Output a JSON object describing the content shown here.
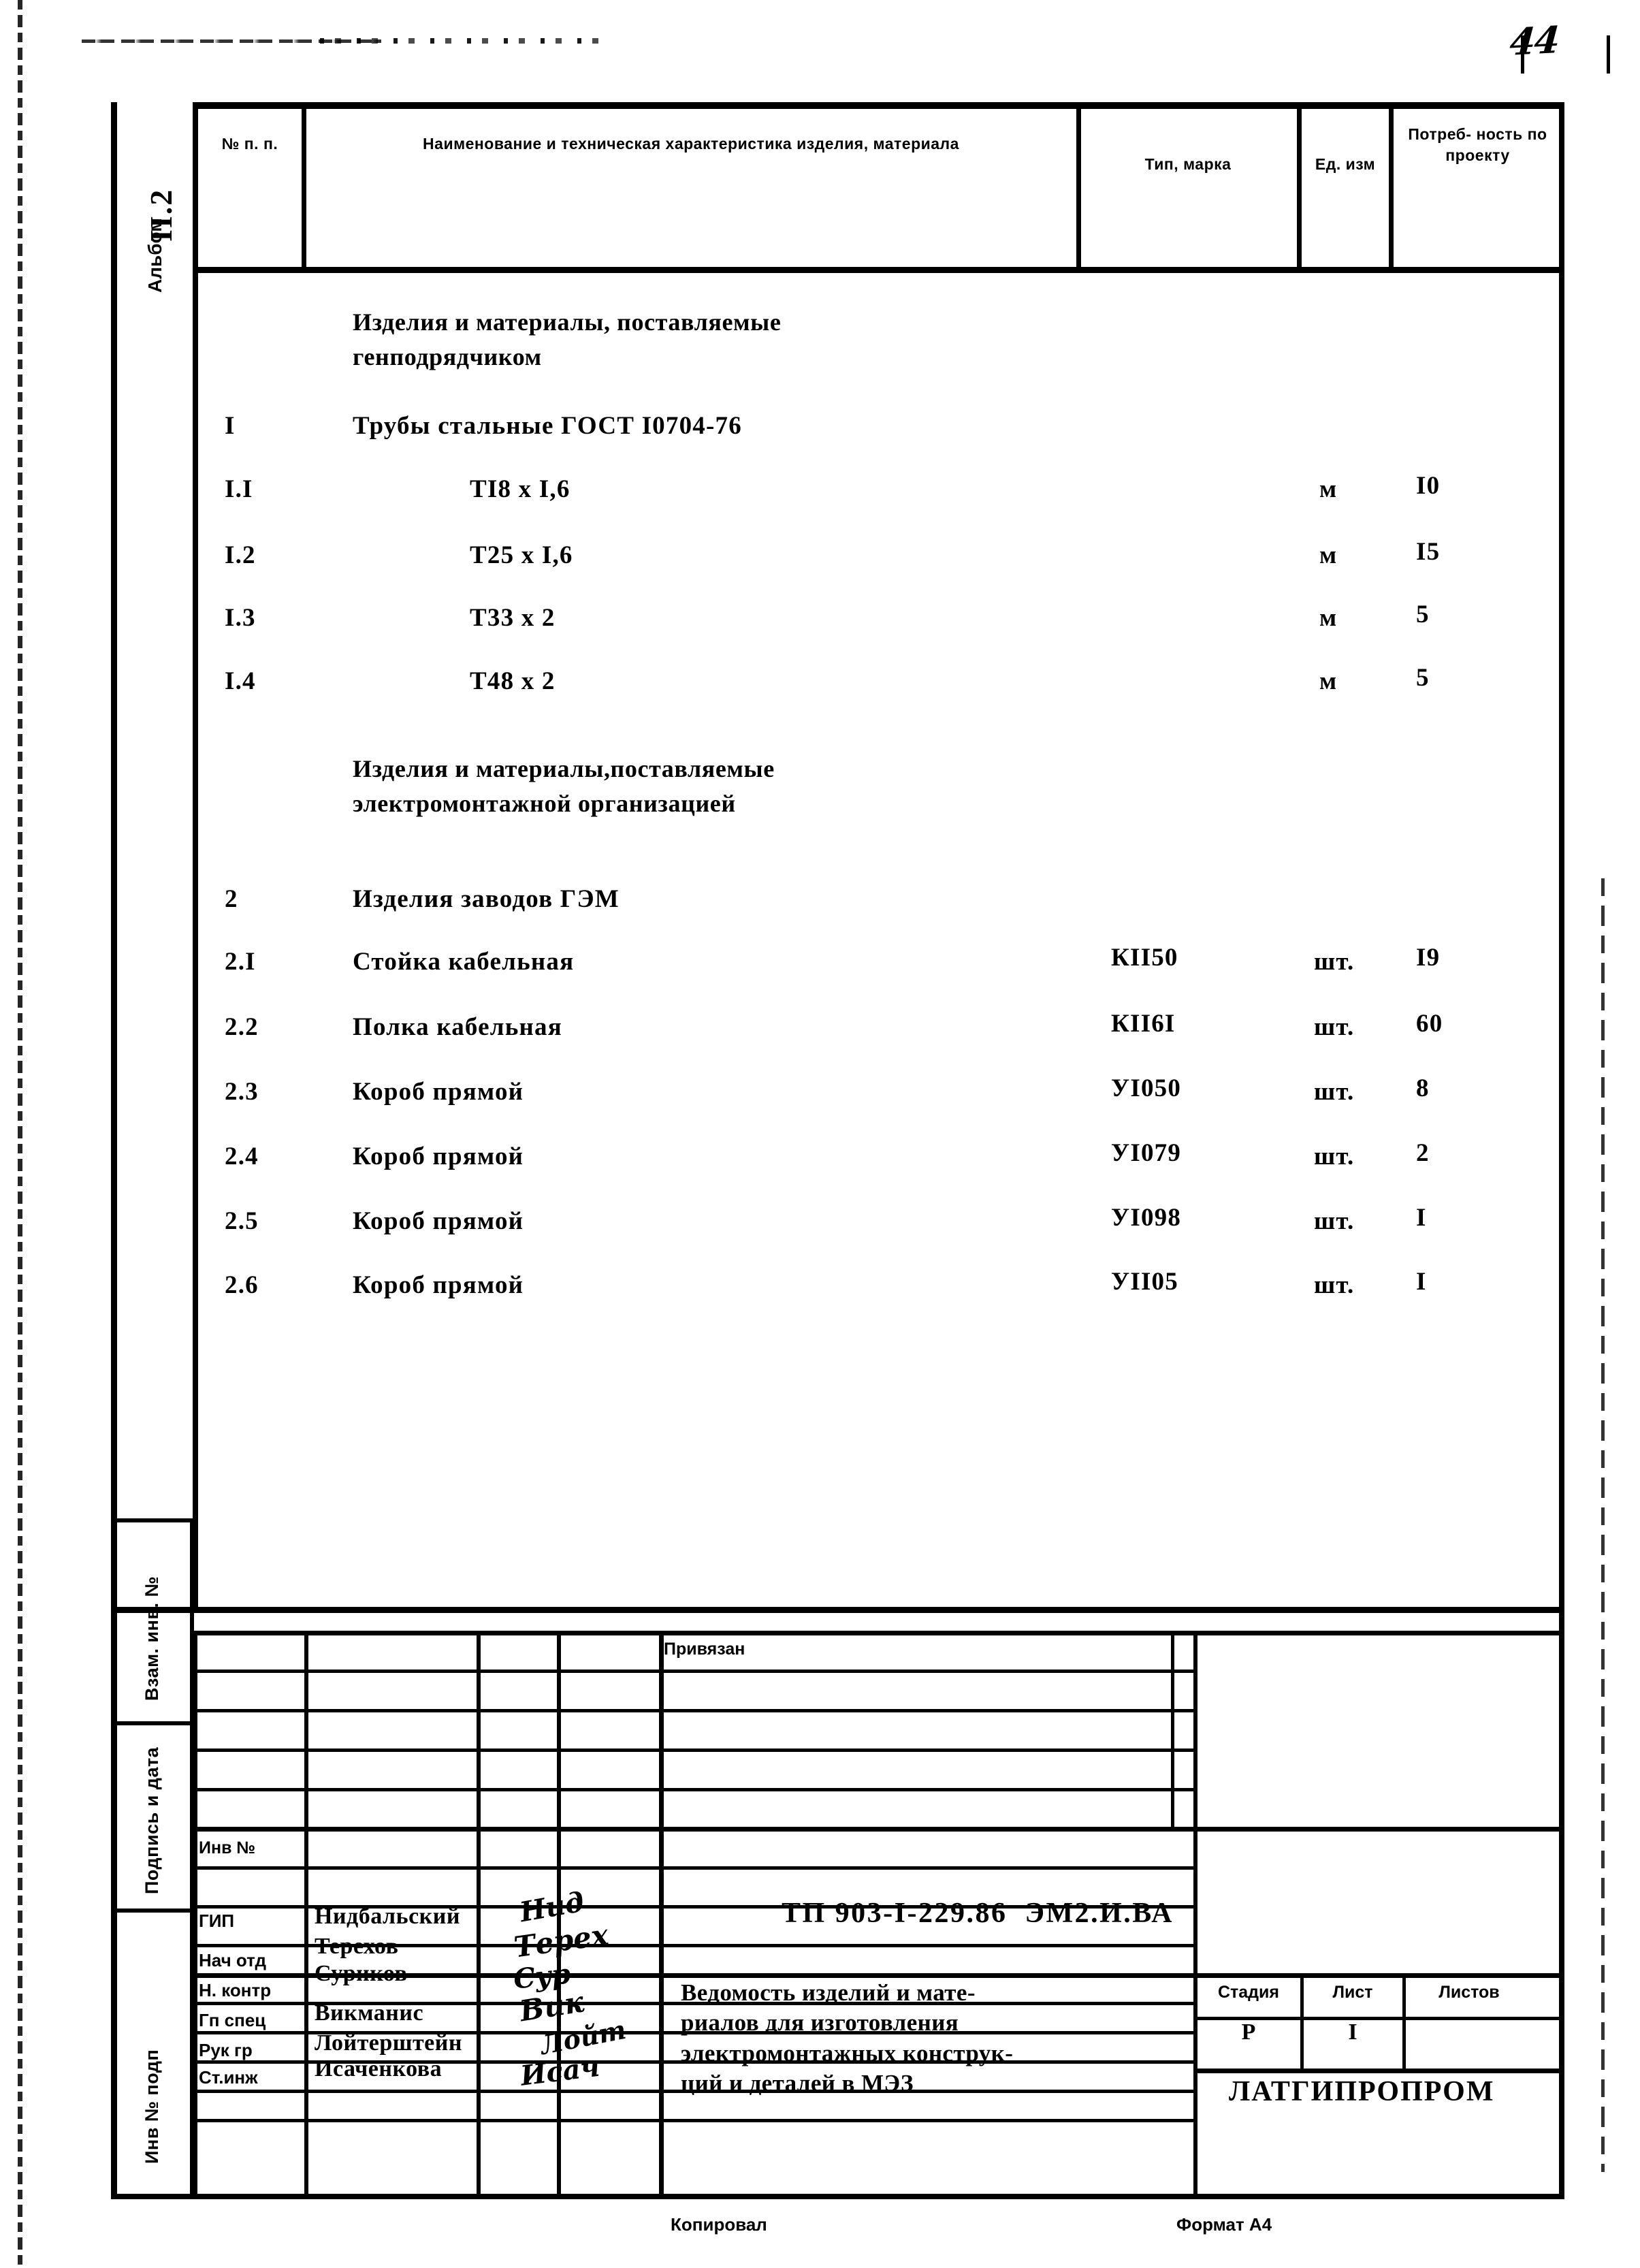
{
  "page": {
    "number": "44",
    "album_code": "II.2",
    "album_word": "Альбом"
  },
  "table": {
    "headers": {
      "no": "№\nп. п.",
      "name": "Наименование и техническая характеристика\nизделия, материала",
      "type": "Тип, марка",
      "unit": "Ед.\nизм",
      "qty": "Потреб-\nность по\nпроекту"
    },
    "rows": [
      {
        "kind": "section",
        "no": "",
        "name": "Изделия и материалы, поставляемые\nгенподрядчиком",
        "type": "",
        "unit": "",
        "qty": ""
      },
      {
        "kind": "group",
        "no": "I",
        "name": "Трубы стальные ГОСТ I0704-76",
        "type": "",
        "unit": "",
        "qty": ""
      },
      {
        "kind": "item",
        "no": "I.I",
        "name": "TI8 x I,6",
        "type": "",
        "unit": "м",
        "qty": "I0"
      },
      {
        "kind": "item",
        "no": "I.2",
        "name": "T25 x I,6",
        "type": "",
        "unit": "м",
        "qty": "I5"
      },
      {
        "kind": "item",
        "no": "I.3",
        "name": "T33 x 2",
        "type": "",
        "unit": "м",
        "qty": "5"
      },
      {
        "kind": "item",
        "no": "I.4",
        "name": "T48 x 2",
        "type": "",
        "unit": "м",
        "qty": "5"
      },
      {
        "kind": "section",
        "no": "",
        "name": "Изделия и материалы,поставляемые\nэлектромонтажной организацией",
        "type": "",
        "unit": "",
        "qty": ""
      },
      {
        "kind": "group",
        "no": "2",
        "name": "Изделия заводов ГЭМ",
        "type": "",
        "unit": "",
        "qty": ""
      },
      {
        "kind": "item",
        "no": "2.I",
        "name": "Стойка кабельная",
        "type": "КII50",
        "unit": "шт.",
        "qty": "I9"
      },
      {
        "kind": "item",
        "no": "2.2",
        "name": "Полка кабельная",
        "type": "КII6I",
        "unit": "шт.",
        "qty": "60"
      },
      {
        "kind": "item",
        "no": "2.3",
        "name": "Короб прямой",
        "type": "УI050",
        "unit": "шт.",
        "qty": "8"
      },
      {
        "kind": "item",
        "no": "2.4",
        "name": "Короб прямой",
        "type": "УI079",
        "unit": "шт.",
        "qty": "2"
      },
      {
        "kind": "item",
        "no": "2.5",
        "name": "Короб прямой",
        "type": "УI098",
        "unit": "шт.",
        "qty": "I"
      },
      {
        "kind": "item",
        "no": "2.6",
        "name": "Короб прямой",
        "type": "УII05",
        "unit": "шт.",
        "qty": "I"
      }
    ]
  },
  "margin_labels": {
    "vzam": "Взам. инв. №",
    "podpis": "Подпись и дата",
    "inv_podp": "Инв № подп"
  },
  "title_block": {
    "privyazan": "Привязан",
    "inv_no": "Инв №",
    "doc_code": "ТП 903-I-229.86  ЭМ2.И.ВА",
    "doc_title": "Ведомость изделий и мате-\nриалов для изготовления\nэлектромонтажных конструк-\nций и деталей в МЭЗ",
    "organization": "ЛАТГИПРОПРОМ",
    "stage": {
      "stage_label": "Стадия",
      "sheet_label": "Лист",
      "sheets_label": "Листов",
      "stage_value": "Р",
      "sheet_value": "I",
      "sheets_value": ""
    },
    "signatures": [
      {
        "role": "ГИП",
        "name": "Нидбальский",
        "mark": "Нид"
      },
      {
        "role": "Нач  отд",
        "name": "Терехов",
        "mark": "Терех"
      },
      {
        "role": "Н. контр",
        "name": "Суриков",
        "mark": "Сур"
      },
      {
        "role": "Гп спец",
        "name": "Викманис",
        "mark": "Вик"
      },
      {
        "role": "Рук гр",
        "name": "Лойтерштейн",
        "mark": "Лойт"
      },
      {
        "role": "Ст.инж",
        "name": "Исаченкова",
        "mark": "Исач"
      }
    ]
  },
  "footer": {
    "copied": "Копировал",
    "format": "Формат А4"
  }
}
